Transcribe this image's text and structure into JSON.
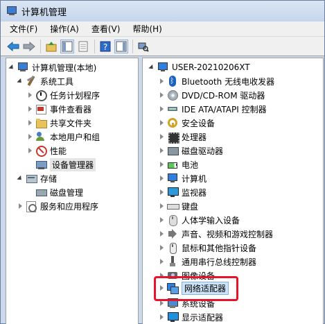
{
  "window": {
    "title": "计算机管理"
  },
  "menu": [
    "文件(F)",
    "操作(A)",
    "查看(V)",
    "帮助(H)"
  ],
  "toolbar": {
    "buttons": [
      "back-icon",
      "forward-icon",
      "up-folder-icon",
      "show-tree-icon",
      "export-icon",
      "help-icon",
      "pane-icon",
      "scan-hardware-icon"
    ]
  },
  "left_tree": [
    {
      "label": "计算机管理(本地)",
      "icon": "computer-icon",
      "level": 0,
      "arrow": "down"
    },
    {
      "label": "系统工具",
      "icon": "tools-icon",
      "level": 1,
      "arrow": "down"
    },
    {
      "label": "任务计划程序",
      "icon": "clock-icon",
      "level": 2,
      "arrow": "right"
    },
    {
      "label": "事件查看器",
      "icon": "event-viewer-icon",
      "level": 2,
      "arrow": "right"
    },
    {
      "label": "共享文件夹",
      "icon": "shared-folder-icon",
      "level": 2,
      "arrow": "right"
    },
    {
      "label": "本地用户和组",
      "icon": "users-icon",
      "level": 2,
      "arrow": "right"
    },
    {
      "label": "性能",
      "icon": "performance-icon",
      "level": 2,
      "arrow": "right"
    },
    {
      "label": "设备管理器",
      "icon": "device-manager-icon",
      "level": 2,
      "arrow": "none",
      "selected": true
    },
    {
      "label": "存储",
      "icon": "storage-icon",
      "level": 1,
      "arrow": "down"
    },
    {
      "label": "磁盘管理",
      "icon": "disk-icon",
      "level": 2,
      "arrow": "none"
    },
    {
      "label": "服务和应用程序",
      "icon": "services-icon",
      "level": 1,
      "arrow": "right"
    }
  ],
  "right_tree": {
    "root": "USER-20210206XT",
    "items": [
      {
        "label": "Bluetooth 无线电收发器",
        "icon": "bluetooth-icon"
      },
      {
        "label": "DVD/CD-ROM 驱动器",
        "icon": "dvd-icon"
      },
      {
        "label": "IDE ATA/ATAPI 控制器",
        "icon": "ide-controller-icon"
      },
      {
        "label": "安全设备",
        "icon": "security-key-icon"
      },
      {
        "label": "处理器",
        "icon": "processor-icon"
      },
      {
        "label": "磁盘驱动器",
        "icon": "disk-drive-icon"
      },
      {
        "label": "电池",
        "icon": "battery-icon"
      },
      {
        "label": "计算机",
        "icon": "computer-icon"
      },
      {
        "label": "监视器",
        "icon": "monitor-icon"
      },
      {
        "label": "键盘",
        "icon": "keyboard-icon"
      },
      {
        "label": "人体学输入设备",
        "icon": "hid-icon"
      },
      {
        "label": "声音、视频和游戏控制器",
        "icon": "sound-icon"
      },
      {
        "label": "鼠标和其他指针设备",
        "icon": "mouse-icon"
      },
      {
        "label": "通用串行总线控制器",
        "icon": "usb-icon"
      },
      {
        "label": "图像设备",
        "icon": "imaging-icon"
      },
      {
        "label": "网络适配器",
        "icon": "network-adapter-icon",
        "highlighted": true
      },
      {
        "label": "系统设备",
        "icon": "system-device-icon"
      },
      {
        "label": "显示适配器",
        "icon": "display-adapter-icon"
      }
    ]
  },
  "colors": {
    "highlight": "#e8132a",
    "selection": "#cde3f7"
  }
}
